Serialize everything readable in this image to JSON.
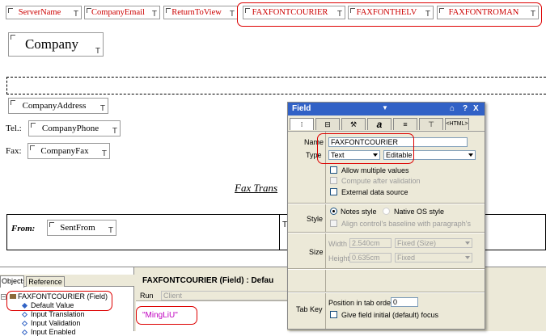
{
  "header_fields": [
    {
      "label": "ServerName",
      "t": "T"
    },
    {
      "label": "CompanyEmail",
      "t": "T"
    },
    {
      "label": "ReturnToView",
      "t": "T"
    },
    {
      "label": "FAXFONTCOURIER",
      "t": "T"
    },
    {
      "label": "FAXFONTHELV",
      "t": "T"
    },
    {
      "label": "FAXFONTROMAN",
      "t": "T"
    }
  ],
  "form": {
    "company": {
      "label": "Company",
      "t": "T"
    },
    "company_address": {
      "label": "CompanyAddress",
      "t": "T"
    },
    "tel_label": "Tel.:",
    "company_phone": {
      "label": "CompanyPhone",
      "t": "T"
    },
    "fax_label": "Fax:",
    "company_fax": {
      "label": "CompanyFax",
      "t": "T"
    },
    "fax_trans": "Fax Trans",
    "from_label": "From:",
    "sent_from": {
      "label": "SentFrom",
      "t": "T"
    },
    "right_cell_mark": "T"
  },
  "dialog": {
    "title": "Field",
    "title_buttons": {
      "dropdown": "▼",
      "pin": "⌂",
      "help": "?",
      "close": "X"
    },
    "tabs": [
      "",
      "",
      "",
      "a",
      "",
      "",
      "<HTML>"
    ],
    "name_label": "Name",
    "name_value": "FAXFONTCOURIER",
    "type_label": "Type",
    "type_value": "Text",
    "editable_value": "Editable",
    "allow_multiple": "Allow multiple values",
    "compute_after": "Compute after validation",
    "external_source": "External data source",
    "style_label": "Style",
    "notes_style": "Notes style",
    "native_style": "Native OS style",
    "align_baseline": "Align control's baseline with paragraph's",
    "size_label": "Size",
    "width_label": "Width",
    "width_value": "2.540cm",
    "width_mode": "Fixed (Size)",
    "height_label": "Height",
    "height_value": "0.635cm",
    "height_mode": "Fixed",
    "tabkey_label": "Tab Key",
    "position_label": "Position in tab order",
    "position_value": "0",
    "initial_focus": "Give field initial (default) focus"
  },
  "objects_pane": {
    "tab_objects": "Objects",
    "tab_reference": "Reference",
    "tree": [
      {
        "label": "FAXFONTCOURIER (Field)",
        "level": 0
      },
      {
        "label": "Default Value",
        "level": 1
      },
      {
        "label": "Input Translation",
        "level": 1
      },
      {
        "label": "Input Validation",
        "level": 1
      },
      {
        "label": "Input Enabled",
        "level": 1
      }
    ]
  },
  "code_pane": {
    "title": "FAXFONTCOURIER (Field) : Defau",
    "run_label": "Run",
    "run_value": "Client",
    "code": "\"MingLiU\""
  },
  "colors": {
    "highlight": "#dd0000",
    "field_text": "#cc0000",
    "dialog_title": "#3161c6",
    "code_text": "#c000c0",
    "dialog_bg": "#ece9d8"
  }
}
